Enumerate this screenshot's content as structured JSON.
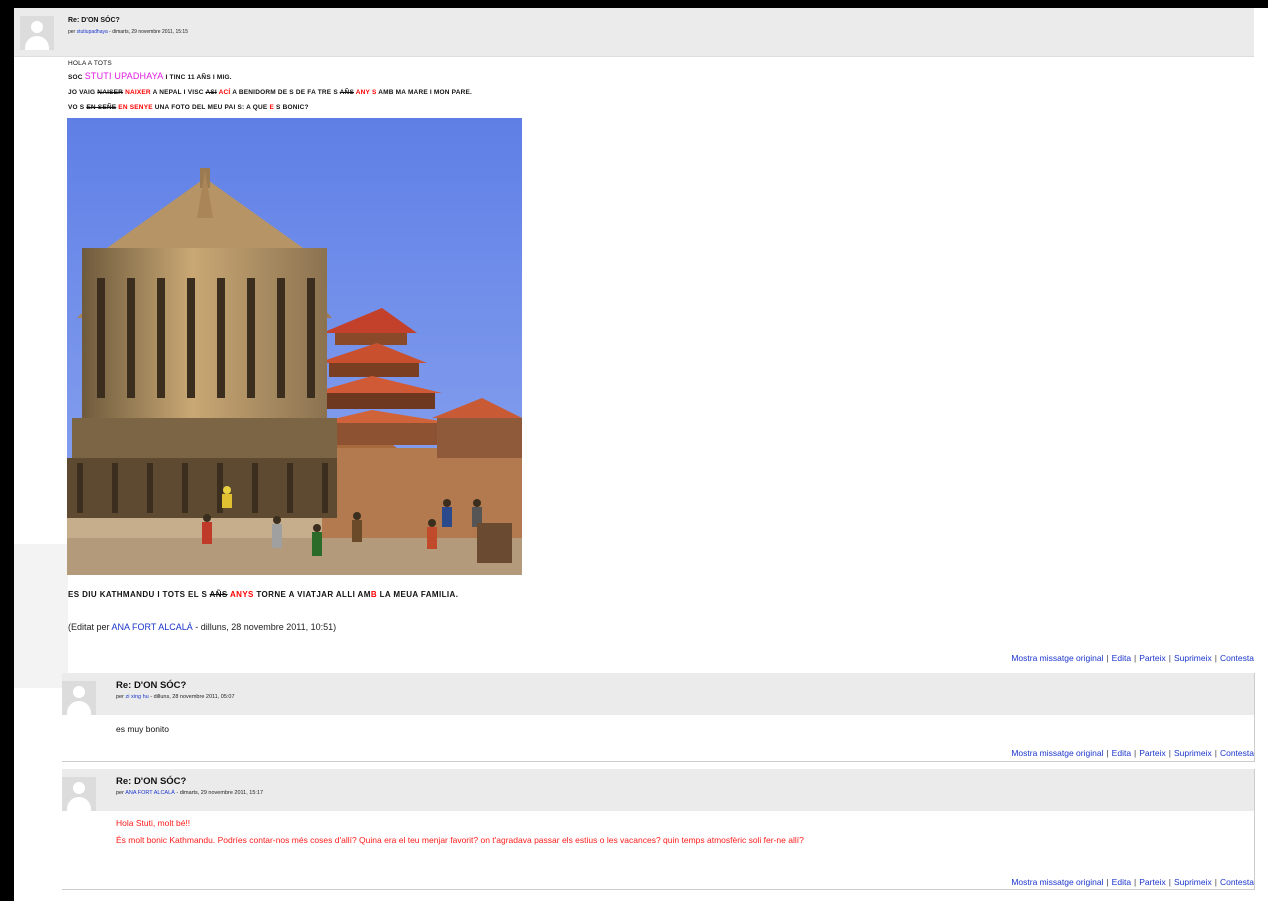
{
  "post1": {
    "subject": "Re: D'ON SÓC?",
    "author_prefix": "per ",
    "author": "stutiupadhaya",
    "date": " - dimarts, 29 novembre 2011, 15:15",
    "lines": {
      "l1": "HOLA A TOTS",
      "l2_a": "SOC ",
      "l2_name": "STUTI UPADHAYA",
      "l2_b": " I TINC 11 AÑS I MIG.",
      "l3_a": "JO VAIG ",
      "l3_strike": "NAISER",
      "l3_red": " NAIXER",
      "l3_b": " A NEPAL I VISC ",
      "l3_strike2": "ASI",
      "l3_red2": " ACÍ",
      "l3_c": " A BENIDORM DE S DE FA TRE S ",
      "l3_strike3": "AÑS",
      "l3_red3": " ANY S",
      "l3_d": " AMB MA MARE I MON PARE.",
      "l4_a": "VO S ",
      "l4_strike": "EN SEÑE",
      "l4_red": " EN SENYE",
      "l4_b": " UNA FOTO DEL MEU PAI S: A QUE ",
      "l4_red2": "E",
      "l4_c": " S BONIC?"
    },
    "kath_a": "ES DIU KATHMANDU I TOTS EL S ",
    "kath_strike": "AÑS",
    "kath_red": " ANYS",
    "kath_b": " TORNE A VIATJAR ALLI AM",
    "kath_red2": "B",
    "kath_c": " LA MEUA FAMILIA.",
    "edit_a": "(Editat per ",
    "edit_name": "ANA FORT ALCALÁ",
    "edit_b": " - dilluns, 28 novembre 2011, 10:51)",
    "photo_alt": "Kathmandu Durbar Square temples"
  },
  "commands": {
    "show_original": "Mostra missatge original",
    "edit": "Edita",
    "split": "Parteix",
    "delete": "Suprimeix",
    "reply": "Contesta",
    "separator": "|"
  },
  "post2": {
    "subject": "Re: D'ON SÓC?",
    "author_prefix": "per ",
    "author": "zi xing hu",
    "date": " - dilluns, 28 novembre 2011, 05:07",
    "text": "es muy bonito"
  },
  "post3": {
    "subject": "Re: D'ON SÓC?",
    "author_prefix": "per ",
    "author": "ANA FORT ALCALÁ",
    "date": " - dimarts, 29 novembre 2011, 15:17",
    "text1": "Hola Stuti, molt bé!!",
    "text2": "És molt bonic Kathmandu. Podríes contar-nos més coses d'allí? Quina era el teu menjar favorit? on t'agradava passar els estius o les vacances? quin temps atmosfèric soli fer-ne allí?"
  },
  "colors": {
    "link": "#1a35cc",
    "red": "#ff0000",
    "magenta": "#e01adf",
    "header_bg": "#ebebeb"
  }
}
